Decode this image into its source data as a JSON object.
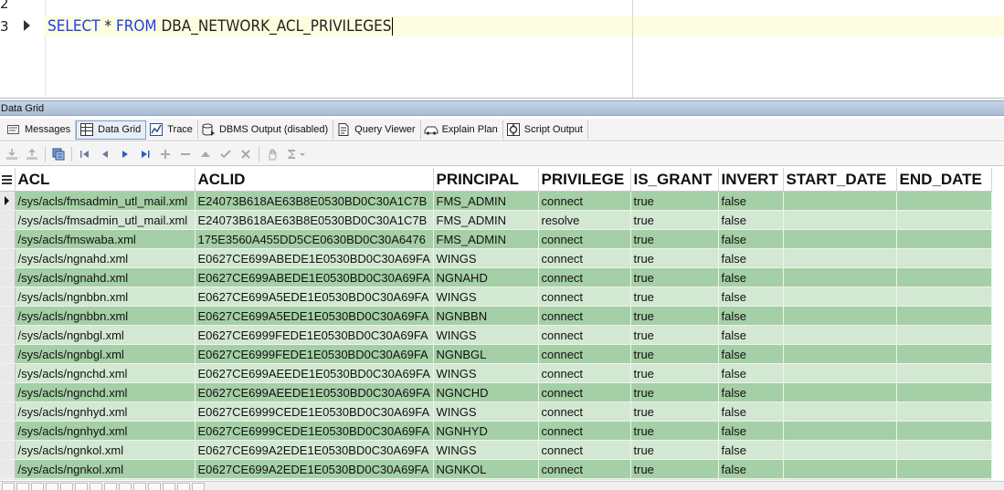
{
  "editor": {
    "line_numbers": [
      "2",
      "3"
    ],
    "sql": {
      "kw1": "SELECT",
      "star": " * ",
      "kw2": "FROM",
      "object": " DBA_NETWORK_ACL_PRIVILEGES"
    }
  },
  "panel": {
    "title": "Data Grid",
    "tabs": [
      {
        "label": "Messages",
        "icon": "messages-icon"
      },
      {
        "label": "Data Grid",
        "icon": "data-grid-icon",
        "active": true
      },
      {
        "label": "Trace",
        "icon": "trace-icon"
      },
      {
        "label": "DBMS Output (disabled)",
        "icon": "dbms-output-icon"
      },
      {
        "label": "Query Viewer",
        "icon": "query-viewer-icon"
      },
      {
        "label": "Explain Plan",
        "icon": "explain-plan-icon"
      },
      {
        "label": "Script Output",
        "icon": "script-output-icon"
      }
    ],
    "toolbar_icons": [
      "import-icon",
      "export-icon",
      "find-icon",
      "first-record-icon",
      "prior-record-icon",
      "next-record-icon",
      "last-record-icon",
      "insert-record-icon",
      "delete-record-icon",
      "edit-record-icon",
      "post-edit-icon",
      "cancel-edit-icon",
      "hand-icon",
      "sum-icon"
    ]
  },
  "grid": {
    "columns": [
      "ACL",
      "ACLID",
      "PRINCIPAL",
      "PRIVILEGE",
      "IS_GRANT",
      "INVERT",
      "START_DATE",
      "END_DATE"
    ],
    "rows": [
      [
        "/sys/acls/fmsadmin_utl_mail.xml",
        "E24073B618AE63B8E0530BD0C30A1C7B",
        "FMS_ADMIN",
        "connect",
        "true",
        "false",
        "",
        ""
      ],
      [
        "/sys/acls/fmsadmin_utl_mail.xml",
        "E24073B618AE63B8E0530BD0C30A1C7B",
        "FMS_ADMIN",
        "resolve",
        "true",
        "false",
        "",
        ""
      ],
      [
        "/sys/acls/fmswaba.xml",
        "175E3560A455DD5CE0630BD0C30A6476",
        "FMS_ADMIN",
        "connect",
        "true",
        "false",
        "",
        ""
      ],
      [
        "/sys/acls/ngnahd.xml",
        "E0627CE699ABEDE1E0530BD0C30A69FA",
        "WINGS",
        "connect",
        "true",
        "false",
        "",
        ""
      ],
      [
        "/sys/acls/ngnahd.xml",
        "E0627CE699ABEDE1E0530BD0C30A69FA",
        "NGNAHD",
        "connect",
        "true",
        "false",
        "",
        ""
      ],
      [
        "/sys/acls/ngnbbn.xml",
        "E0627CE699A5EDE1E0530BD0C30A69FA",
        "WINGS",
        "connect",
        "true",
        "false",
        "",
        ""
      ],
      [
        "/sys/acls/ngnbbn.xml",
        "E0627CE699A5EDE1E0530BD0C30A69FA",
        "NGNBBN",
        "connect",
        "true",
        "false",
        "",
        ""
      ],
      [
        "/sys/acls/ngnbgl.xml",
        "E0627CE6999FEDE1E0530BD0C30A69FA",
        "WINGS",
        "connect",
        "true",
        "false",
        "",
        ""
      ],
      [
        "/sys/acls/ngnbgl.xml",
        "E0627CE6999FEDE1E0530BD0C30A69FA",
        "NGNBGL",
        "connect",
        "true",
        "false",
        "",
        ""
      ],
      [
        "/sys/acls/ngnchd.xml",
        "E0627CE699AEEDE1E0530BD0C30A69FA",
        "WINGS",
        "connect",
        "true",
        "false",
        "",
        ""
      ],
      [
        "/sys/acls/ngnchd.xml",
        "E0627CE699AEEDE1E0530BD0C30A69FA",
        "NGNCHD",
        "connect",
        "true",
        "false",
        "",
        ""
      ],
      [
        "/sys/acls/ngnhyd.xml",
        "E0627CE6999CEDE1E0530BD0C30A69FA",
        "WINGS",
        "connect",
        "true",
        "false",
        "",
        ""
      ],
      [
        "/sys/acls/ngnhyd.xml",
        "E0627CE6999CEDE1E0530BD0C30A69FA",
        "NGNHYD",
        "connect",
        "true",
        "false",
        "",
        ""
      ],
      [
        "/sys/acls/ngnkol.xml",
        "E0627CE699A2EDE1E0530BD0C30A69FA",
        "WINGS",
        "connect",
        "true",
        "false",
        "",
        ""
      ],
      [
        "/sys/acls/ngnkol.xml",
        "E0627CE699A2EDE1E0530BD0C30A69FA",
        "NGNKOL",
        "connect",
        "true",
        "false",
        "",
        ""
      ],
      [
        "",
        "",
        "",
        "",
        "",
        "",
        "",
        ""
      ]
    ]
  }
}
